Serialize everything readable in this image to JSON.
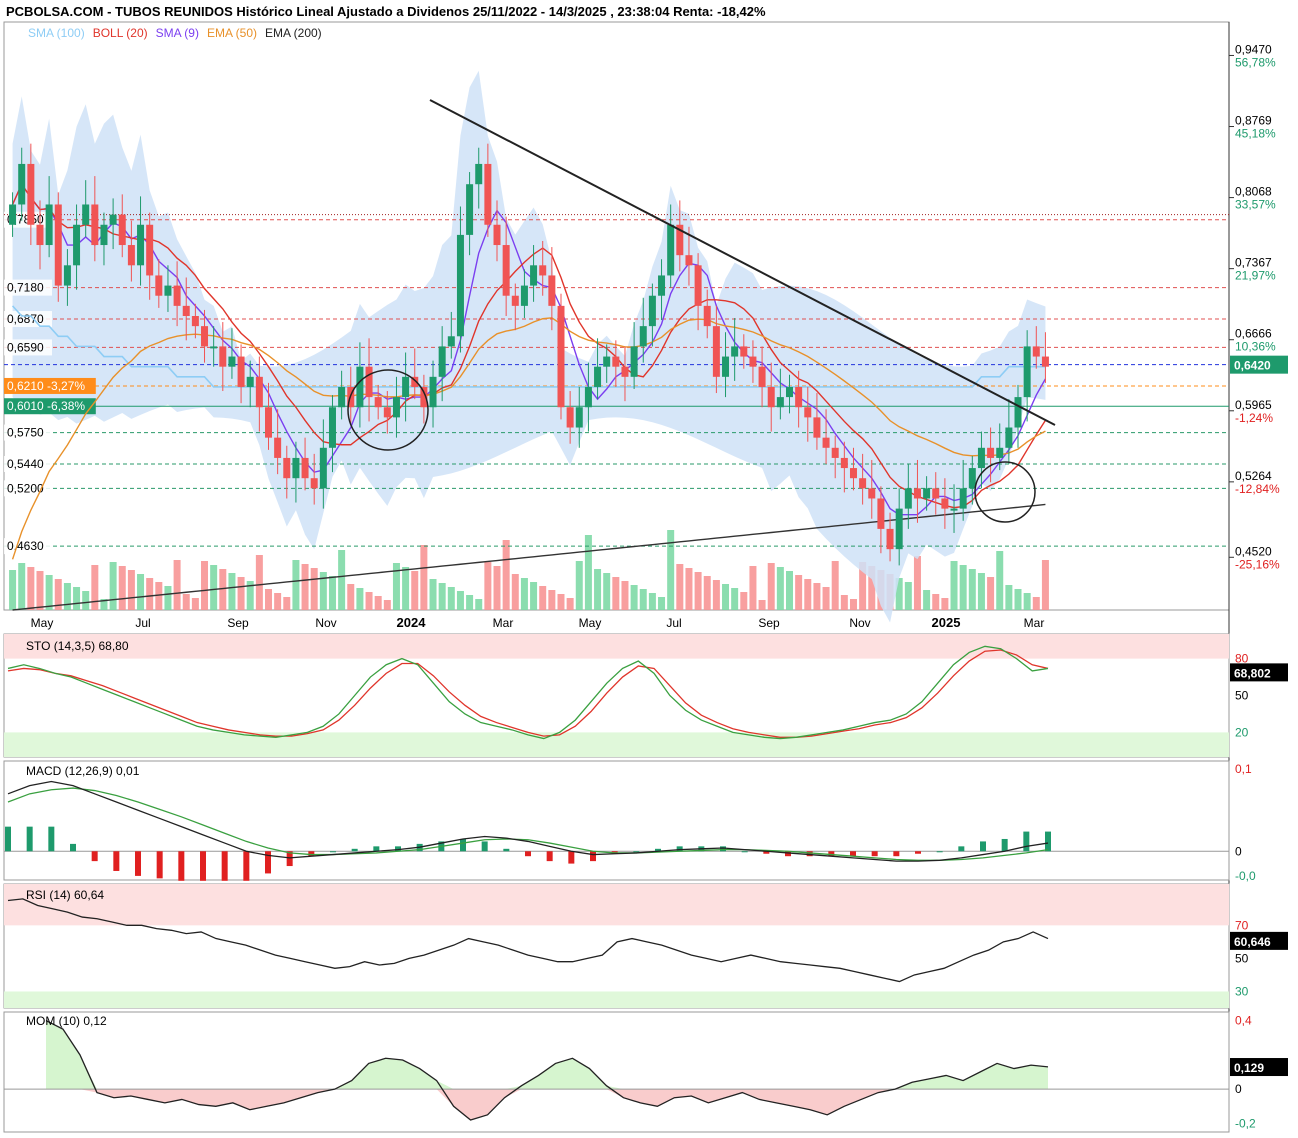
{
  "header": {
    "title": "PCBOLSA.COM - TUBOS REUNIDOS Histórico Lineal Ajustado a Dividenos 25/11/2022 - 14/3/2025 , 23:38:04 Renta: -18,42%"
  },
  "legend": [
    {
      "label": "SMA (100)",
      "color": "#8ecdf5"
    },
    {
      "label": "BOLL (20)",
      "color": "#e0352b"
    },
    {
      "label": "SMA (9)",
      "color": "#7b3ff0"
    },
    {
      "label": "EMA (50)",
      "color": "#e8912a"
    },
    {
      "label": "EMA (200)",
      "color": "#222222"
    }
  ],
  "colors": {
    "up": "#1e9a6c",
    "down": "#f05454",
    "boll_fill": "#cfe2f7",
    "grid": "#dddddd"
  },
  "chart_data": [
    {
      "type": "candlestick",
      "title": "TUBOS REUNIDOS",
      "ylim": [
        0.4,
        0.98
      ],
      "y_ticks_right": [
        {
          "value": 0.947,
          "label": "0,9470",
          "pct": "56,78%"
        },
        {
          "value": 0.8769,
          "label": "0,8769",
          "pct": "45,18%"
        },
        {
          "value": 0.8068,
          "label": "0,8068",
          "pct": "33,57%"
        },
        {
          "value": 0.7367,
          "label": "0,7367",
          "pct": "21,97%"
        },
        {
          "value": 0.6666,
          "label": "0,6666",
          "pct": "10,36%"
        },
        {
          "value": 0.5965,
          "label": "0,5965",
          "pct": "-1,24%"
        },
        {
          "value": 0.5264,
          "label": "0,5264",
          "pct": "-12,84%"
        },
        {
          "value": 0.452,
          "label": "0,4520",
          "pct": "-25,16%"
        }
      ],
      "last_price": {
        "value": 0.642,
        "label": "0,6420"
      },
      "levels_left": [
        {
          "value": 0.785,
          "label": "0,7850"
        },
        {
          "value": 0.718,
          "label": "0,7180"
        },
        {
          "value": 0.687,
          "label": "0,6870"
        },
        {
          "value": 0.659,
          "label": "0,6590"
        },
        {
          "value": 0.621,
          "label": "0,6210 -3,27%",
          "highlight": "#ff8c1a"
        },
        {
          "value": 0.601,
          "label": "0,6010 -6,38%",
          "highlight": "#1e9a6c"
        },
        {
          "value": 0.575,
          "label": "0,5750"
        },
        {
          "value": 0.544,
          "label": "0,5440"
        },
        {
          "value": 0.52,
          "label": "0,5200"
        },
        {
          "value": 0.463,
          "label": "0,4630"
        }
      ],
      "x_labels": [
        {
          "label": "May",
          "bold": false
        },
        {
          "label": "Jul",
          "bold": false
        },
        {
          "label": "Sep",
          "bold": false
        },
        {
          "label": "Nov",
          "bold": false
        },
        {
          "label": "2024",
          "bold": true
        },
        {
          "label": "Mar",
          "bold": false
        },
        {
          "label": "May",
          "bold": false
        },
        {
          "label": "Jul",
          "bold": false
        },
        {
          "label": "Sep",
          "bold": false
        },
        {
          "label": "Nov",
          "bold": false
        },
        {
          "label": "2025",
          "bold": true
        },
        {
          "label": "Mar",
          "bold": false
        }
      ],
      "closes": [
        0.8,
        0.84,
        0.78,
        0.76,
        0.8,
        0.72,
        0.74,
        0.78,
        0.8,
        0.76,
        0.78,
        0.79,
        0.76,
        0.74,
        0.78,
        0.73,
        0.71,
        0.72,
        0.7,
        0.69,
        0.68,
        0.66,
        0.66,
        0.64,
        0.65,
        0.62,
        0.63,
        0.6,
        0.57,
        0.55,
        0.53,
        0.55,
        0.53,
        0.52,
        0.56,
        0.6,
        0.62,
        0.6,
        0.64,
        0.61,
        0.6,
        0.59,
        0.61,
        0.63,
        0.62,
        0.6,
        0.63,
        0.66,
        0.67,
        0.77,
        0.82,
        0.84,
        0.78,
        0.76,
        0.71,
        0.7,
        0.72,
        0.74,
        0.73,
        0.7,
        0.6,
        0.58,
        0.6,
        0.62,
        0.64,
        0.65,
        0.64,
        0.63,
        0.66,
        0.68,
        0.71,
        0.73,
        0.78,
        0.75,
        0.74,
        0.7,
        0.68,
        0.63,
        0.65,
        0.66,
        0.65,
        0.64,
        0.62,
        0.6,
        0.61,
        0.62,
        0.6,
        0.59,
        0.57,
        0.56,
        0.55,
        0.54,
        0.53,
        0.52,
        0.51,
        0.48,
        0.46,
        0.5,
        0.52,
        0.51,
        0.52,
        0.51,
        0.5,
        0.5,
        0.52,
        0.54,
        0.56,
        0.55,
        0.56,
        0.58,
        0.61,
        0.66,
        0.65,
        0.64
      ],
      "sma100": [
        0.7,
        0.69,
        0.69,
        0.68,
        0.68,
        0.67,
        0.67,
        0.66,
        0.66,
        0.66,
        0.65,
        0.65,
        0.65,
        0.64,
        0.64,
        0.64,
        0.64,
        0.64,
        0.63,
        0.63,
        0.63,
        0.63,
        0.62,
        0.62,
        0.62,
        0.62,
        0.62,
        0.62,
        0.62,
        0.62,
        0.62,
        0.62,
        0.62,
        0.62,
        0.62,
        0.62,
        0.62,
        0.62,
        0.62,
        0.62,
        0.62,
        0.62,
        0.62,
        0.62,
        0.62,
        0.62,
        0.62,
        0.62,
        0.62,
        0.62,
        0.62,
        0.62,
        0.62,
        0.62,
        0.62,
        0.62,
        0.62,
        0.62,
        0.62,
        0.62,
        0.62,
        0.62,
        0.62,
        0.62,
        0.62,
        0.62,
        0.62,
        0.62,
        0.62,
        0.62,
        0.62,
        0.62,
        0.62,
        0.62,
        0.62,
        0.62,
        0.62,
        0.62,
        0.62,
        0.62,
        0.62,
        0.62,
        0.62,
        0.62,
        0.62,
        0.62,
        0.62,
        0.62,
        0.62,
        0.62,
        0.62,
        0.62,
        0.62,
        0.62,
        0.62,
        0.62,
        0.62,
        0.62,
        0.62,
        0.62,
        0.62,
        0.62,
        0.62,
        0.62,
        0.62,
        0.62,
        0.63,
        0.63,
        0.63,
        0.64,
        0.64,
        0.64,
        0.64,
        0.64
      ],
      "stoch": {
        "label": "STO (14,3,5)",
        "value": "68,80",
        "last": "68,802",
        "ticks": [
          {
            "v": 80,
            "label": "80"
          },
          {
            "v": 50,
            "label": "50"
          },
          {
            "v": 20,
            "label": "20"
          }
        ],
        "k": [
          72,
          75,
          72,
          68,
          65,
          60,
          55,
          50,
          45,
          40,
          35,
          30,
          25,
          22,
          20,
          18,
          17,
          16,
          18,
          20,
          25,
          35,
          50,
          65,
          75,
          80,
          75,
          60,
          45,
          35,
          28,
          25,
          22,
          18,
          15,
          20,
          30,
          45,
          60,
          72,
          78,
          68,
          50,
          38,
          30,
          25,
          20,
          18,
          16,
          15,
          16,
          18,
          20,
          22,
          25,
          28,
          30,
          35,
          45,
          60,
          75,
          85,
          90,
          88,
          80,
          70,
          72
        ],
        "d": [
          70,
          72,
          71,
          68,
          66,
          62,
          58,
          53,
          48,
          43,
          38,
          33,
          28,
          25,
          22,
          20,
          18,
          17,
          17,
          19,
          22,
          30,
          42,
          56,
          68,
          76,
          76,
          66,
          53,
          42,
          33,
          28,
          24,
          20,
          17,
          18,
          25,
          37,
          52,
          65,
          74,
          72,
          58,
          44,
          34,
          28,
          23,
          20,
          18,
          16,
          16,
          17,
          19,
          21,
          23,
          26,
          28,
          32,
          40,
          52,
          66,
          78,
          86,
          87,
          83,
          75,
          72
        ]
      },
      "macd": {
        "label": "MACD (12,26,9)",
        "value": "0,01",
        "ticks": [
          {
            "v": 0.1,
            "label": "0,1"
          },
          {
            "v": 0,
            "label": "0"
          },
          {
            "v": -0.03,
            "label": "-0,0"
          }
        ],
        "macd": [
          0.07,
          0.08,
          0.085,
          0.08,
          0.07,
          0.06,
          0.05,
          0.04,
          0.03,
          0.02,
          0.01,
          0.0,
          -0.005,
          -0.008,
          -0.006,
          -0.004,
          -0.002,
          0.0,
          0.002,
          0.005,
          0.01,
          0.015,
          0.018,
          0.016,
          0.012,
          0.006,
          0.0,
          -0.004,
          -0.003,
          -0.002,
          0.0,
          0.002,
          0.003,
          0.004,
          0.002,
          0.0,
          -0.002,
          -0.004,
          -0.006,
          -0.008,
          -0.01,
          -0.012,
          -0.012,
          -0.011,
          -0.008,
          -0.004,
          0.0,
          0.006,
          0.01
        ],
        "signal": [
          0.06,
          0.07,
          0.075,
          0.077,
          0.074,
          0.068,
          0.06,
          0.051,
          0.042,
          0.032,
          0.022,
          0.012,
          0.004,
          -0.002,
          -0.004,
          -0.004,
          -0.003,
          -0.002,
          0.0,
          0.002,
          0.006,
          0.01,
          0.014,
          0.015,
          0.014,
          0.01,
          0.005,
          0.0,
          -0.002,
          -0.002,
          -0.001,
          0.0,
          0.001,
          0.002,
          0.002,
          0.001,
          0.0,
          -0.002,
          -0.004,
          -0.006,
          -0.008,
          -0.01,
          -0.011,
          -0.011,
          -0.01,
          -0.008,
          -0.005,
          -0.002,
          0.002
        ]
      },
      "rsi": {
        "label": "RSI (14)",
        "value": "60,64",
        "last": "60,646",
        "ticks": [
          {
            "v": 70,
            "label": "70"
          },
          {
            "v": 50,
            "label": "50"
          },
          {
            "v": 30,
            "label": "30"
          }
        ],
        "values": [
          85,
          86,
          82,
          80,
          78,
          75,
          74,
          72,
          70,
          70,
          68,
          67,
          65,
          66,
          62,
          60,
          58,
          55,
          52,
          50,
          48,
          46,
          44,
          45,
          48,
          46,
          47,
          50,
          52,
          55,
          58,
          62,
          60,
          58,
          55,
          52,
          50,
          48,
          48,
          50,
          52,
          60,
          62,
          60,
          58,
          55,
          52,
          50,
          48,
          50,
          52,
          50,
          48,
          47,
          46,
          45,
          44,
          42,
          40,
          38,
          36,
          40,
          42,
          44,
          48,
          52,
          55,
          60,
          62,
          66,
          62
        ]
      },
      "mom": {
        "label": "MOM (10)",
        "value": "0,12",
        "last": "0,129",
        "ticks": [
          {
            "v": 0.4,
            "label": "0,4"
          },
          {
            "v": 0,
            "label": "0"
          },
          {
            "v": -0.2,
            "label": "-0,2"
          }
        ],
        "values": [
          0.4,
          0.35,
          0.2,
          -0.02,
          -0.05,
          -0.04,
          -0.06,
          -0.08,
          -0.06,
          -0.09,
          -0.1,
          -0.08,
          -0.12,
          -0.1,
          -0.08,
          -0.05,
          -0.02,
          0.0,
          0.05,
          0.15,
          0.18,
          0.17,
          0.12,
          0.05,
          -0.1,
          -0.18,
          -0.15,
          -0.05,
          0.02,
          0.08,
          0.15,
          0.18,
          0.12,
          0.02,
          -0.05,
          -0.08,
          -0.1,
          -0.05,
          -0.04,
          -0.08,
          -0.05,
          -0.02,
          -0.06,
          -0.08,
          -0.1,
          -0.12,
          -0.15,
          -0.1,
          -0.06,
          -0.02,
          0.0,
          0.04,
          0.06,
          0.08,
          0.05,
          0.1,
          0.15,
          0.12,
          0.14,
          0.13
        ]
      }
    }
  ]
}
